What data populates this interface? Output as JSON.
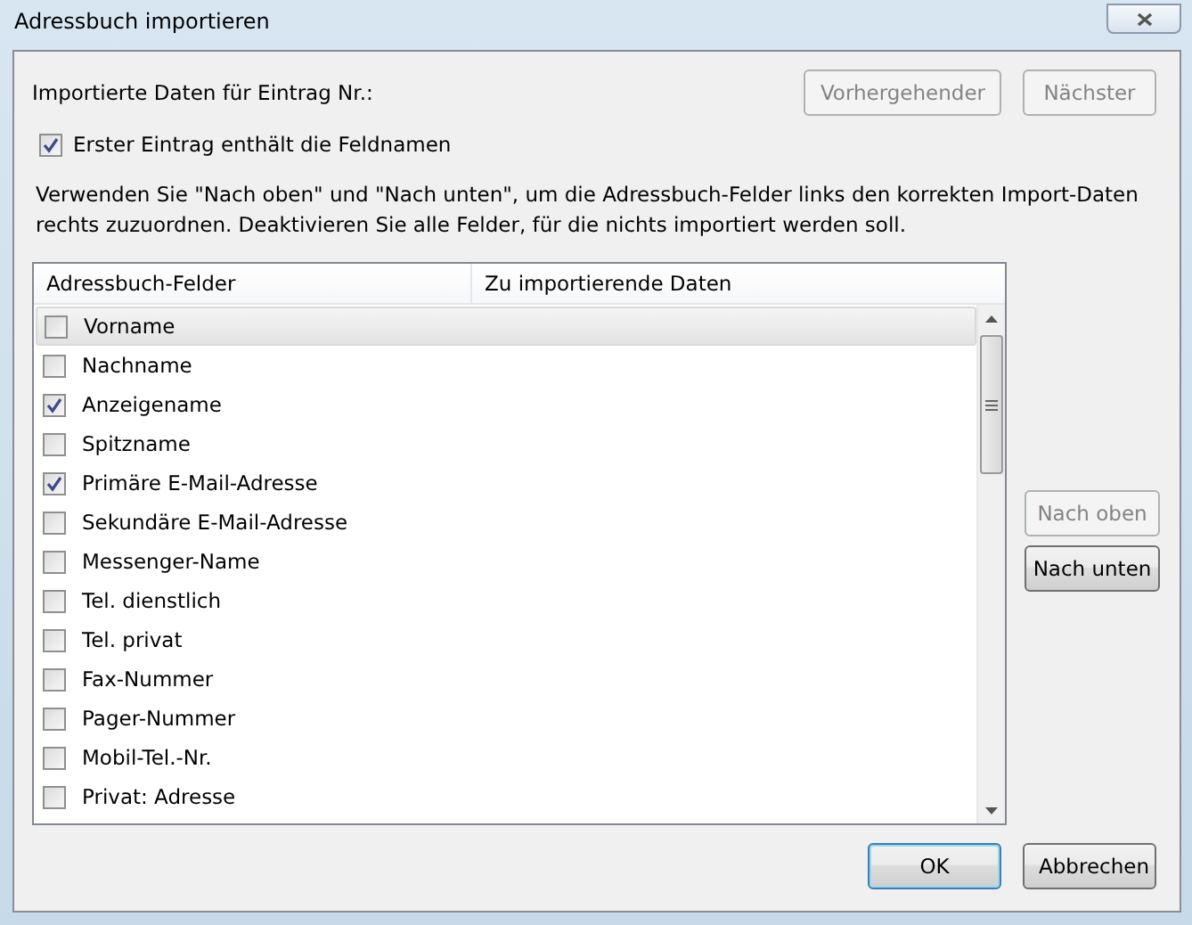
{
  "window": {
    "title": "Adressbuch importieren"
  },
  "entry_label": "Importierte Daten für Eintrag Nr.:",
  "nav_buttons": [
    {
      "label": "Vorhergehender",
      "disabled": true
    },
    {
      "label": "Nächster",
      "disabled": true
    }
  ],
  "first_row_checkbox": {
    "label": "Erster Eintrag enthält die Feldnamen",
    "checked": true
  },
  "instructions": "Verwenden Sie \"Nach oben\" und \"Nach unten\", um die Adressbuch-Felder links den korrekten Import-Daten rechts zuzuordnen. Deaktivieren Sie alle Felder, für die nichts importiert werden soll.",
  "table": {
    "columns": [
      "Adressbuch-Felder",
      "Zu importierende Daten"
    ],
    "rows": [
      {
        "field": "Vorname",
        "checked": false,
        "selected": true
      },
      {
        "field": "Nachname",
        "checked": false,
        "selected": false
      },
      {
        "field": "Anzeigename",
        "checked": true,
        "selected": false
      },
      {
        "field": "Spitzname",
        "checked": false,
        "selected": false
      },
      {
        "field": "Primäre E-Mail-Adresse",
        "checked": true,
        "selected": false
      },
      {
        "field": "Sekundäre E-Mail-Adresse",
        "checked": false,
        "selected": false
      },
      {
        "field": "Messenger-Name",
        "checked": false,
        "selected": false
      },
      {
        "field": "Tel. dienstlich",
        "checked": false,
        "selected": false
      },
      {
        "field": "Tel. privat",
        "checked": false,
        "selected": false
      },
      {
        "field": "Fax-Nummer",
        "checked": false,
        "selected": false
      },
      {
        "field": "Pager-Nummer",
        "checked": false,
        "selected": false
      },
      {
        "field": "Mobil-Tel.-Nr.",
        "checked": false,
        "selected": false
      },
      {
        "field": "Privat: Adresse",
        "checked": false,
        "selected": false
      }
    ]
  },
  "move_buttons": [
    {
      "label": "Nach oben",
      "disabled": true
    },
    {
      "label": "Nach unten",
      "disabled": false
    }
  ],
  "dialog_buttons": [
    {
      "label": "OK",
      "default": true
    },
    {
      "label": "Abbrechen",
      "default": false
    }
  ]
}
